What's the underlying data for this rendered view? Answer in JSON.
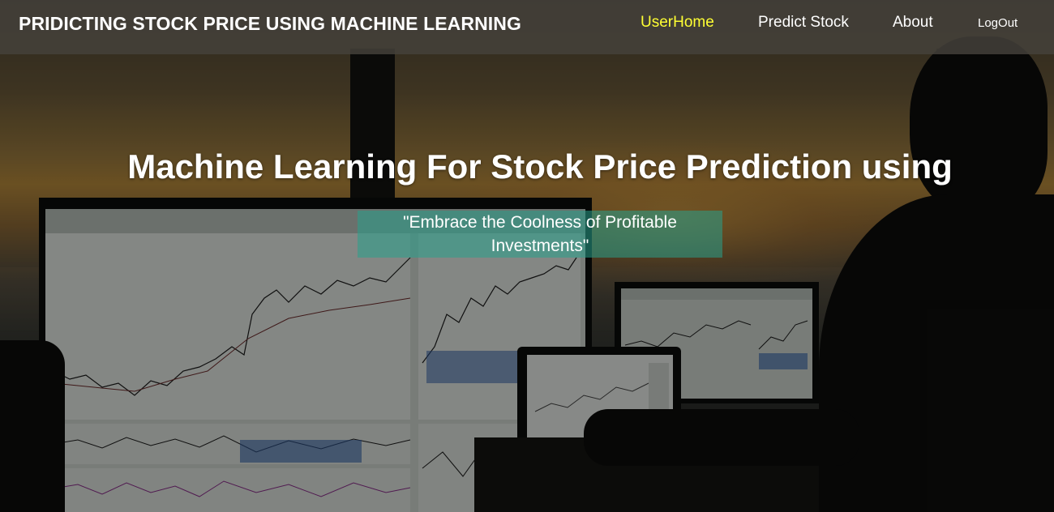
{
  "header": {
    "brand": "PRIDICTING STOCK PRICE USING MACHINE LEARNING",
    "nav": [
      {
        "label": "UserHome",
        "active": true
      },
      {
        "label": "Predict Stock",
        "active": false
      },
      {
        "label": "About",
        "active": false
      },
      {
        "label": "LogOut",
        "active": false
      }
    ]
  },
  "hero": {
    "title": "Machine Learning For Stock Price Prediction using",
    "tagline": "\"Embrace the Coolness of Profitable Investments\""
  },
  "colors": {
    "navbar_bg": "#46423c",
    "active_link": "#ffff33",
    "tagline_bg": "#28a08c"
  }
}
